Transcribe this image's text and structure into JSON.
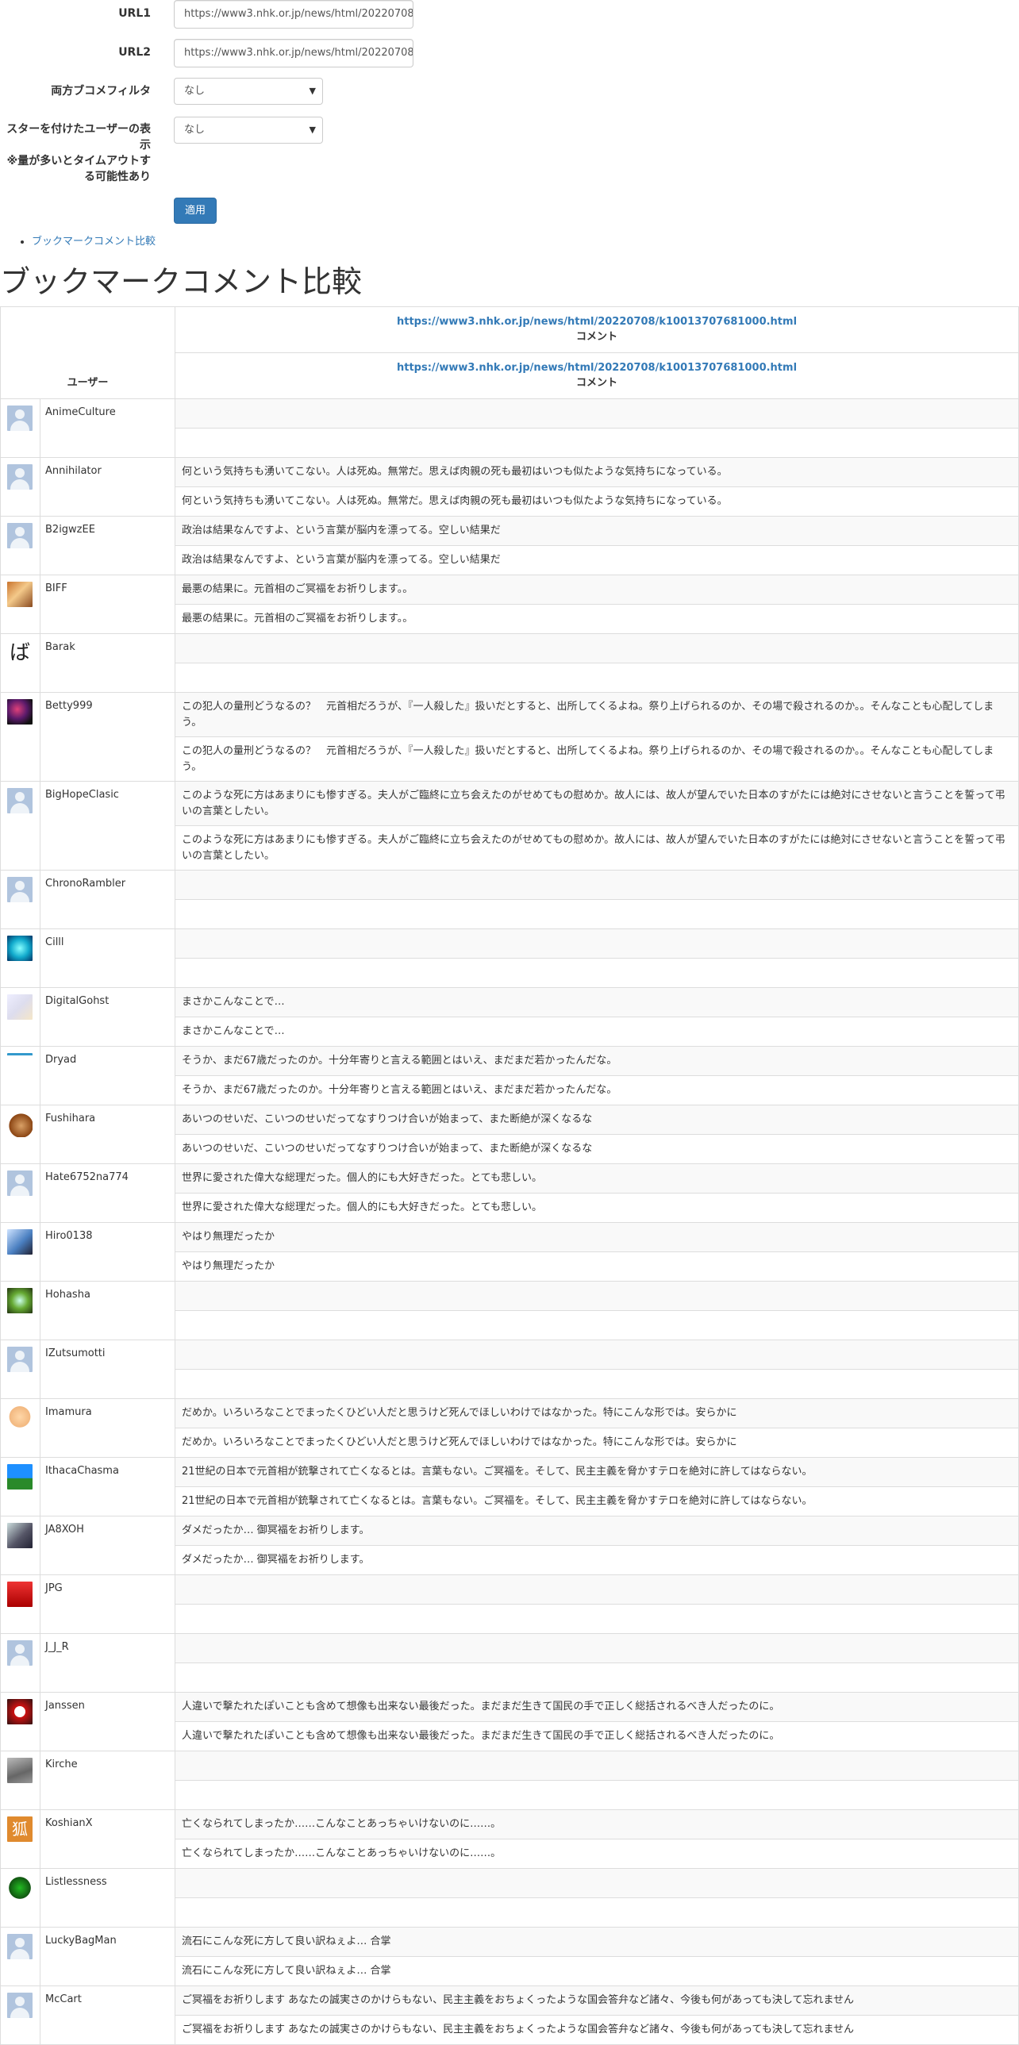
{
  "form": {
    "url1_label": "URL1",
    "url1_value": "https://www3.nhk.or.jp/news/html/20220708/k10013707681000.html",
    "url2_label": "URL2",
    "url2_value": "https://www3.nhk.or.jp/news/html/20220708/k10013707681000.html",
    "filter_label": "両方ブコメフィルタ",
    "filter_value": "なし",
    "star_label_1": "スターを付けたユーザーの表示",
    "star_label_2": "※量が多いとタイムアウトする可能性あり",
    "star_value": "なし",
    "apply_button": "適用"
  },
  "nav": {
    "link": "ブックマークコメント比較"
  },
  "page_title": "ブックマークコメント比較",
  "table": {
    "user_header": "ユーザー",
    "url1": "https://www3.nhk.or.jp/news/html/20220708/k10013707681000.html",
    "url2": "https://www3.nhk.or.jp/news/html/20220708/k10013707681000.html",
    "comment_header": "コメント",
    "rows": [
      {
        "user": "AnimeCulture",
        "c1": "",
        "c2": ""
      },
      {
        "user": "Annihilator",
        "c1": "何という気持ちも湧いてこない。人は死ぬ。無常だ。思えば肉親の死も最初はいつも似たような気持ちになっている。",
        "c2": "何という気持ちも湧いてこない。人は死ぬ。無常だ。思えば肉親の死も最初はいつも似たような気持ちになっている。"
      },
      {
        "user": "B2igwzEE",
        "c1": "政治は結果なんですよ、という言葉が脳内を漂ってる。空しい結果だ",
        "c2": "政治は結果なんですよ、という言葉が脳内を漂ってる。空しい結果だ"
      },
      {
        "user": "BIFF",
        "c1": "最悪の結果に。元首相のご冥福をお祈りします。。",
        "c2": "最悪の結果に。元首相のご冥福をお祈りします。。"
      },
      {
        "user": "Barak",
        "c1": "",
        "c2": ""
      },
      {
        "user": "Betty999",
        "c1": "この犯人の量刑どうなるの？　元首相だろうが、『一人殺した』扱いだとすると、出所してくるよね。祭り上げられるのか、その場で殺されるのか。。そんなことも心配してしまう。",
        "c2": "この犯人の量刑どうなるの？　元首相だろうが、『一人殺した』扱いだとすると、出所してくるよね。祭り上げられるのか、その場で殺されるのか。。そんなことも心配してしまう。"
      },
      {
        "user": "BigHopeClasic",
        "c1": "このような死に方はあまりにも惨すぎる。夫人がご臨終に立ち会えたのがせめてもの慰めか。故人には、故人が望んでいた日本のすがたには絶対にさせないと言うことを誓って弔いの言葉としたい。",
        "c2": "このような死に方はあまりにも惨すぎる。夫人がご臨終に立ち会えたのがせめてもの慰めか。故人には、故人が望んでいた日本のすがたには絶対にさせないと言うことを誓って弔いの言葉としたい。"
      },
      {
        "user": "ChronoRambler",
        "c1": "",
        "c2": ""
      },
      {
        "user": "Cilll",
        "c1": "",
        "c2": ""
      },
      {
        "user": "DigitalGohst",
        "c1": "まさかこんなことで…",
        "c2": "まさかこんなことで…"
      },
      {
        "user": "Dryad",
        "c1": "そうか、まだ67歳だったのか。十分年寄りと言える範囲とはいえ、まだまだ若かったんだな。",
        "c2": "そうか、まだ67歳だったのか。十分年寄りと言える範囲とはいえ、まだまだ若かったんだな。"
      },
      {
        "user": "Fushihara",
        "c1": "あいつのせいだ、こいつのせいだってなすりつけ合いが始まって、また断絶が深くなるな",
        "c2": "あいつのせいだ、こいつのせいだってなすりつけ合いが始まって、また断絶が深くなるな"
      },
      {
        "user": "Hate6752na774",
        "c1": "世界に愛された偉大な総理だった。個人的にも大好きだった。とても悲しい。",
        "c2": "世界に愛された偉大な総理だった。個人的にも大好きだった。とても悲しい。"
      },
      {
        "user": "Hiro0138",
        "c1": "やはり無理だったか",
        "c2": "やはり無理だったか"
      },
      {
        "user": "Hohasha",
        "c1": "",
        "c2": ""
      },
      {
        "user": "IZutsumotti",
        "c1": "",
        "c2": ""
      },
      {
        "user": "Imamura",
        "c1": "だめか。いろいろなことでまったくひどい人だと思うけど死んでほしいわけではなかった。特にこんな形では。安らかに",
        "c2": "だめか。いろいろなことでまったくひどい人だと思うけど死んでほしいわけではなかった。特にこんな形では。安らかに"
      },
      {
        "user": "IthacaChasma",
        "c1": "21世紀の日本で元首相が銃撃されて亡くなるとは。言葉もない。ご冥福を。そして、民主主義を脅かすテロを絶対に許してはならない。",
        "c2": "21世紀の日本で元首相が銃撃されて亡くなるとは。言葉もない。ご冥福を。そして、民主主義を脅かすテロを絶対に許してはならない。"
      },
      {
        "user": "JA8XOH",
        "c1": "ダメだったか… 御冥福をお祈りします。",
        "c2": "ダメだったか… 御冥福をお祈りします。"
      },
      {
        "user": "JPG",
        "c1": "",
        "c2": ""
      },
      {
        "user": "J_J_R",
        "c1": "",
        "c2": ""
      },
      {
        "user": "Janssen",
        "c1": "人違いで撃たれたぽいことも含めて想像も出来ない最後だった。まだまだ生きて国民の手で正しく総括されるべき人だったのに。",
        "c2": "人違いで撃たれたぽいことも含めて想像も出来ない最後だった。まだまだ生きて国民の手で正しく総括されるべき人だったのに。"
      },
      {
        "user": "Kirche",
        "c1": "",
        "c2": ""
      },
      {
        "user": "KoshianX",
        "c1": "亡くなられてしまったか……こんなことあっちゃいけないのに……。",
        "c2": "亡くなられてしまったか……こんなことあっちゃいけないのに……。"
      },
      {
        "user": "Listlessness",
        "c1": "",
        "c2": ""
      },
      {
        "user": "LuckyBagMan",
        "c1": "流石にこんな死に方して良い訳ねぇよ… 合掌",
        "c2": "流石にこんな死に方して良い訳ねぇよ… 合掌"
      },
      {
        "user": "McCart",
        "c1": "ご冥福をお祈りします あなたの誠実さのかけらもない、民主主義をおちょくったような国会答弁など諸々、今後も何があっても決して忘れません",
        "c2": "ご冥福をお祈りします あなたの誠実さのかけらもない、民主主義をおちょくったような国会答弁など諸々、今後も何があっても決して忘れません"
      }
    ]
  },
  "avatars": [
    "default",
    "default",
    "default",
    "anime",
    "text-ba",
    "galaxy",
    "default",
    "default",
    "cyan",
    "light",
    "face",
    "brown",
    "default",
    "blue",
    "green",
    "default",
    "glasses",
    "tree",
    "person",
    "red",
    "default",
    "mask",
    "gray",
    "fox",
    "turtle",
    "default",
    "default"
  ],
  "avatar_text": {
    "text-ba": "ば",
    "fox": "狐"
  }
}
